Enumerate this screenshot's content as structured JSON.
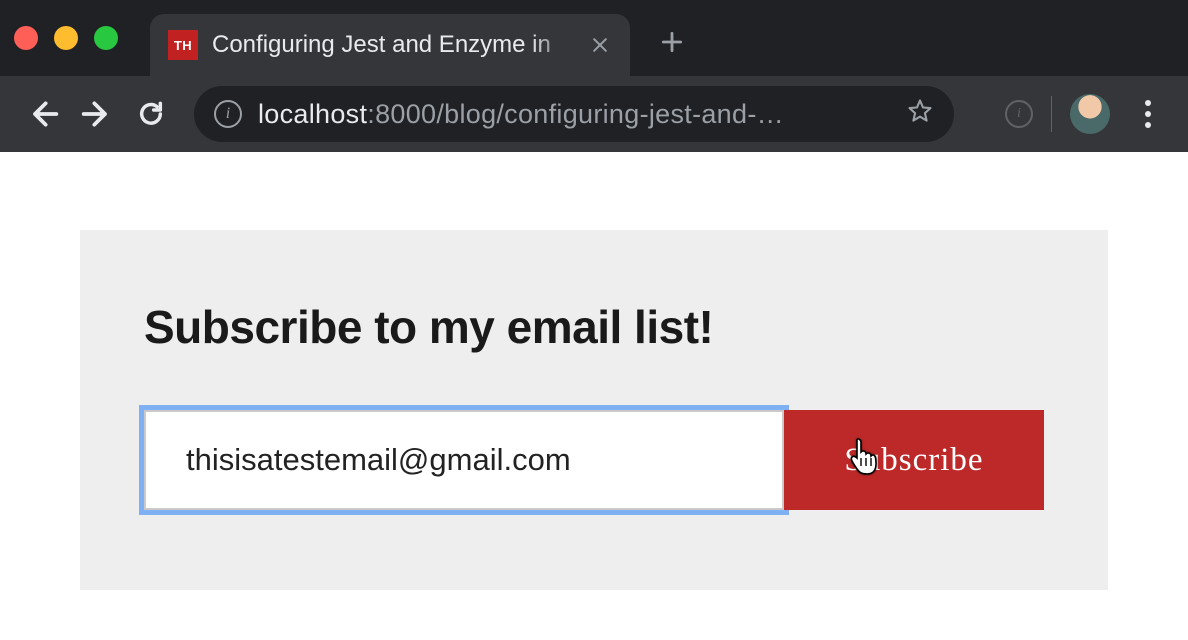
{
  "browser": {
    "tab": {
      "favicon_text": "TH",
      "title": "Configuring Jest and Enzyme in"
    },
    "url": {
      "host": "localhost",
      "path": ":8000/blog/configuring-jest-and-…"
    }
  },
  "page": {
    "subscribe": {
      "heading": "Subscribe to my email list!",
      "email_value": "thisisatestemail@gmail.com",
      "button_label": "Subscribe"
    }
  }
}
